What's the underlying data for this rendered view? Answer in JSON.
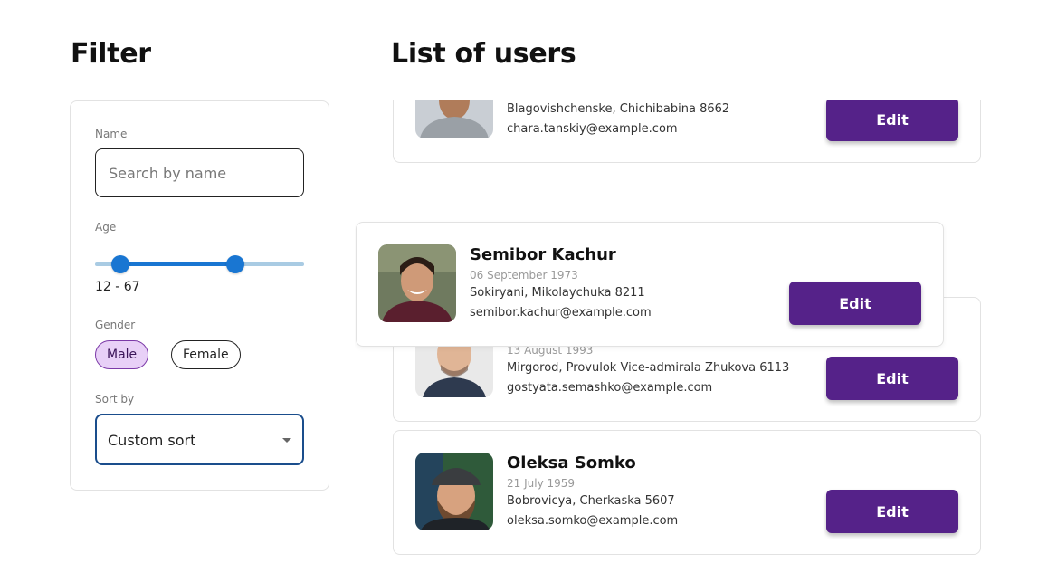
{
  "filter": {
    "title": "Filter",
    "name_label": "Name",
    "name_placeholder": "Search by name",
    "name_value": "",
    "age_label": "Age",
    "age_min": 12,
    "age_max": 67,
    "age_range_text": "12 - 67",
    "gender_label": "Gender",
    "gender_options": [
      "Male",
      "Female"
    ],
    "gender_selected": "Male",
    "sort_label": "Sort by",
    "sort_value": "Custom sort"
  },
  "list": {
    "title": "List of users",
    "users": [
      {
        "name": "",
        "dob": "",
        "address": "Blagovishchenske, Chichibabina 8662",
        "email": "chara.tanskiy@example.com",
        "edit_label": "Edit"
      },
      {
        "name": "",
        "dob": "13 August 1993",
        "address": "Mirgorod, Provulok Vice-admirala Zhukova 6113",
        "email": "gostyata.semashko@example.com",
        "edit_label": "Edit"
      },
      {
        "name": "Oleksa Somko",
        "dob": "21 July 1959",
        "address": "Bobrovicya, Cherkaska 5607",
        "email": "oleksa.somko@example.com",
        "edit_label": "Edit"
      }
    ],
    "dragged_user": {
      "name": "Semibor Kachur",
      "dob": "06 September 1973",
      "address": "Sokiryani, Mikolaychuka 8211",
      "email": "semibor.kachur@example.com",
      "edit_label": "Edit"
    }
  },
  "colors": {
    "accent": "#552289",
    "slider": "#1976d2",
    "chip_selected_bg": "#e8d0f7",
    "select_border": "#1a4d8c"
  }
}
